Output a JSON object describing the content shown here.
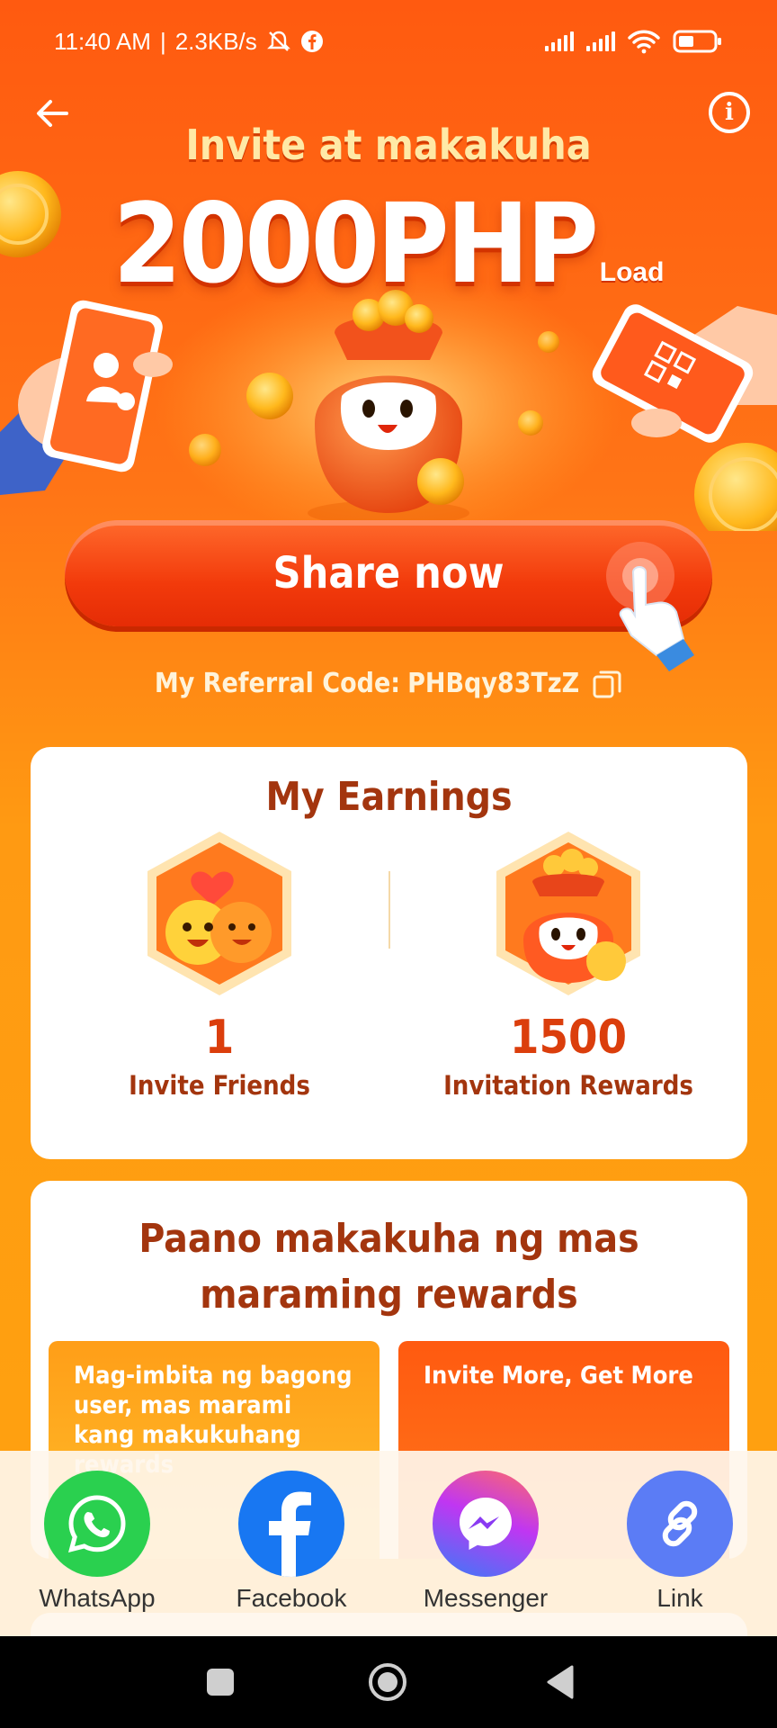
{
  "status_bar": {
    "time": "11:40 AM",
    "net_speed": "2.3KB/s"
  },
  "header": {
    "headline": "Invite at makakuha",
    "amount": "2000PHP",
    "amount_unit": "Load"
  },
  "share_button": {
    "label": "Share now"
  },
  "referral": {
    "label": "My Referral Code:",
    "code": "PHBqy83TzZ"
  },
  "earnings": {
    "title": "My Earnings",
    "invite_friends": {
      "value": "1",
      "label": "Invite Friends"
    },
    "invitation_rewards": {
      "value": "1500",
      "label": "Invitation Rewards"
    }
  },
  "how_to": {
    "title": "Paano makakuha ng mas maraming rewards",
    "tiles": [
      {
        "text": "Mag-imbita ng bagong user, mas marami kang makukuhang rewards"
      },
      {
        "text": "Invite More, Get More"
      }
    ]
  },
  "share_sheet": {
    "options": [
      {
        "label": "WhatsApp",
        "icon": "whatsapp-icon",
        "color": "#2AD04F"
      },
      {
        "label": "Facebook",
        "icon": "facebook-icon",
        "color": "#1877F2"
      },
      {
        "label": "Messenger",
        "icon": "messenger-icon",
        "color": "#A334FA"
      },
      {
        "label": "Link",
        "icon": "link-icon",
        "color": "#5B7CF5"
      }
    ]
  },
  "colors": {
    "brand_orange": "#FF5A10",
    "accent_brown": "#A3350E",
    "accent_red": "#DB3E0C"
  }
}
